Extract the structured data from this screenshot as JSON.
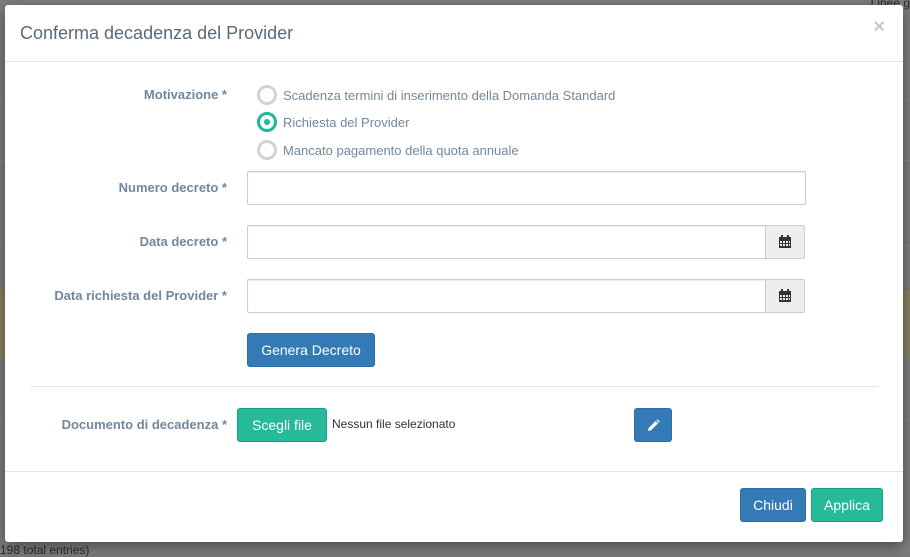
{
  "background": {
    "top_right_text": "Linee g",
    "bottom_left_text": "198 total entries)"
  },
  "modal": {
    "title": "Conferma decadenza del Provider",
    "close_symbol": "×"
  },
  "form": {
    "motivazione_label": "Motivazione *",
    "motivazione_options": [
      {
        "label": "Scadenza termini di inserimento della Domanda Standard",
        "checked": false
      },
      {
        "label": "Richiesta del Provider",
        "checked": true
      },
      {
        "label": "Mancato pagamento della quota annuale",
        "checked": false
      }
    ],
    "numero_decreto_label": "Numero decreto *",
    "numero_decreto_value": "",
    "data_decreto_label": "Data decreto *",
    "data_decreto_value": "",
    "data_richiesta_label": "Data richiesta del Provider *",
    "data_richiesta_value": "",
    "genera_decreto_button": "Genera Decreto",
    "documento_label": "Documento di decadenza *",
    "choose_file_button": "Scegli file",
    "no_file_text": "Nessun file selezionato"
  },
  "footer": {
    "close_button": "Chiudi",
    "apply_button": "Applica"
  },
  "icons": {
    "calendar": "calendar-icon",
    "edit": "pencil-icon"
  },
  "colors": {
    "primary": "#337ab7",
    "success": "#26B99A",
    "radio_checked": "#1ABB9C",
    "label": "#73879C"
  }
}
